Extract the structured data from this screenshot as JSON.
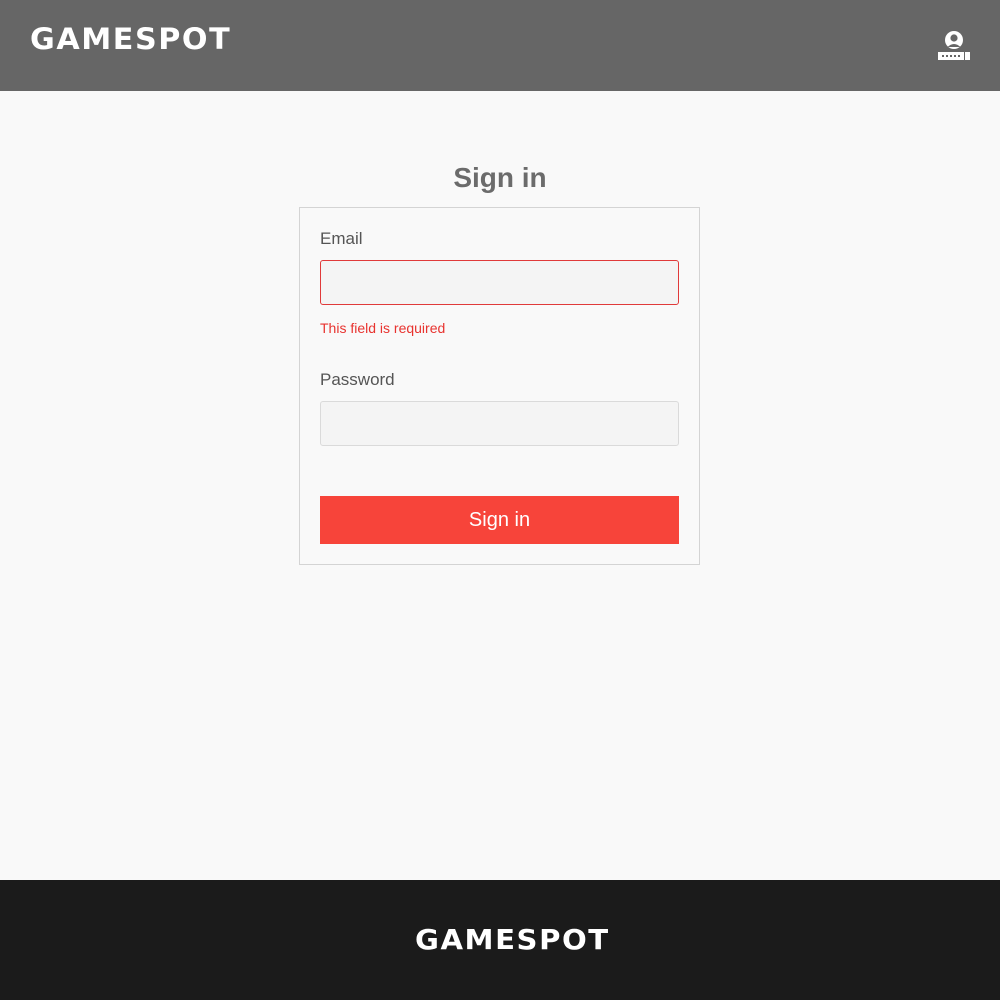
{
  "header": {
    "logo": "GAMESPOT",
    "account_icon": "account-user-icon"
  },
  "signin": {
    "title": "Sign in",
    "email_label": "Email",
    "email_value": "",
    "email_error": "This field is required",
    "password_label": "Password",
    "password_value": "",
    "submit_label": "Sign in"
  },
  "footer": {
    "logo": "GAMESPOT"
  },
  "colors": {
    "header_bg": "#666666",
    "footer_bg": "#1b1b1b",
    "accent": "#f7443a",
    "error": "#e8332f"
  }
}
